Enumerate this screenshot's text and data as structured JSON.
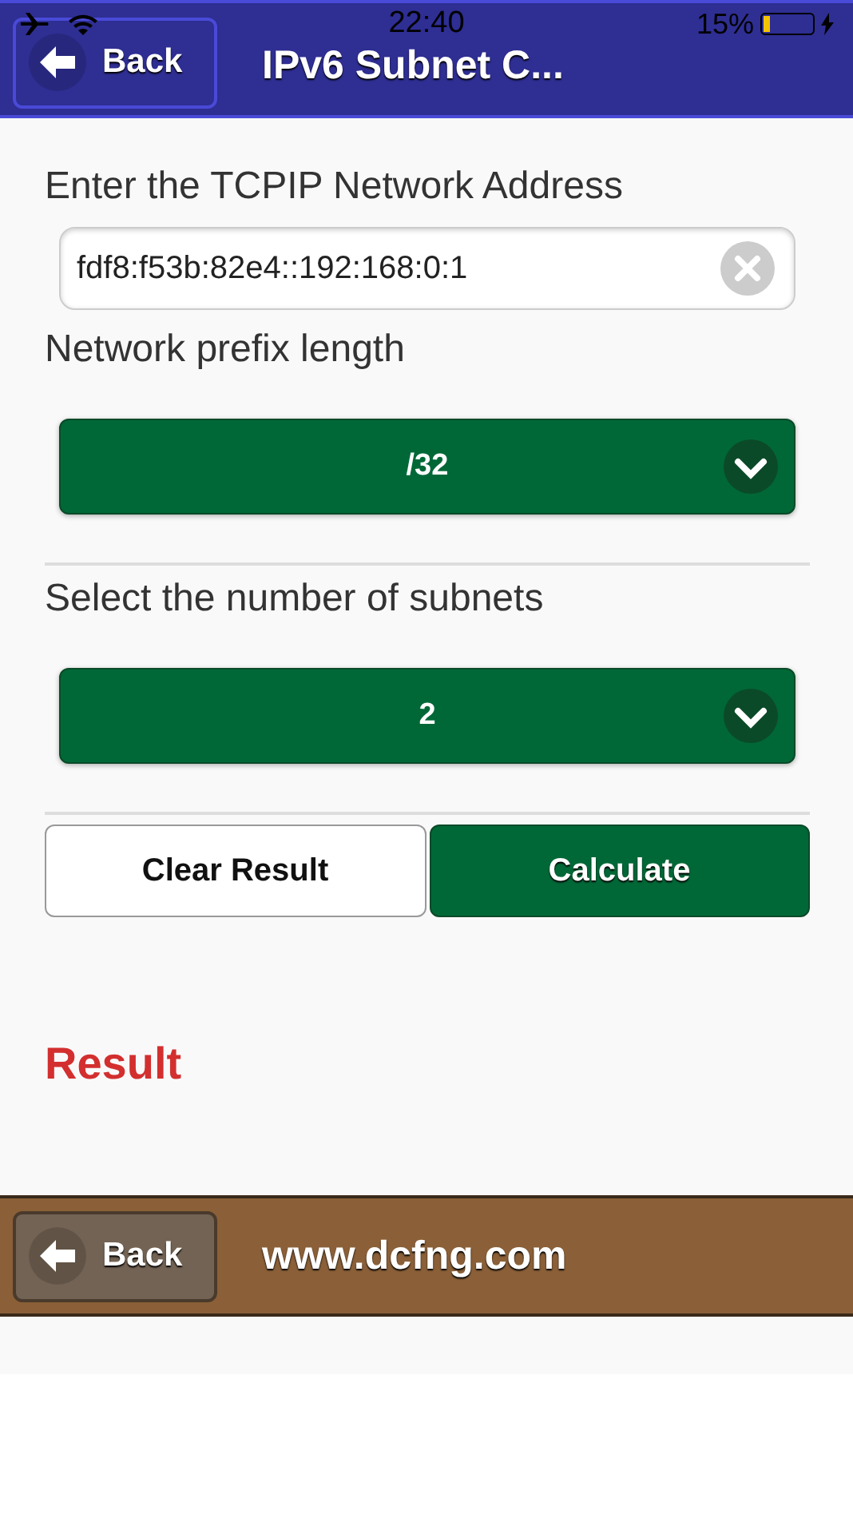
{
  "status_bar": {
    "time": "22:40",
    "battery_percent": "15%",
    "battery": {
      "level": 0.15
    }
  },
  "header": {
    "back_button": "Back",
    "title": "IPv6 Subnet C..."
  },
  "address": {
    "label": "Enter the TCPIP Network Address",
    "value": "fdf8:f53b:82e4::192:168:0:1"
  },
  "prefix": {
    "label": "Network prefix length",
    "value": "/32"
  },
  "subnets": {
    "label": "Select the number of subnets",
    "value": "2"
  },
  "buttons": [
    {
      "label": "Clear Result",
      "kind": "secondary"
    },
    {
      "label": "Calculate",
      "kind": "primary"
    }
  ],
  "result": {
    "heading": "Result"
  },
  "footer": {
    "back_button": "Back",
    "site": "www.dcfng.com"
  }
}
